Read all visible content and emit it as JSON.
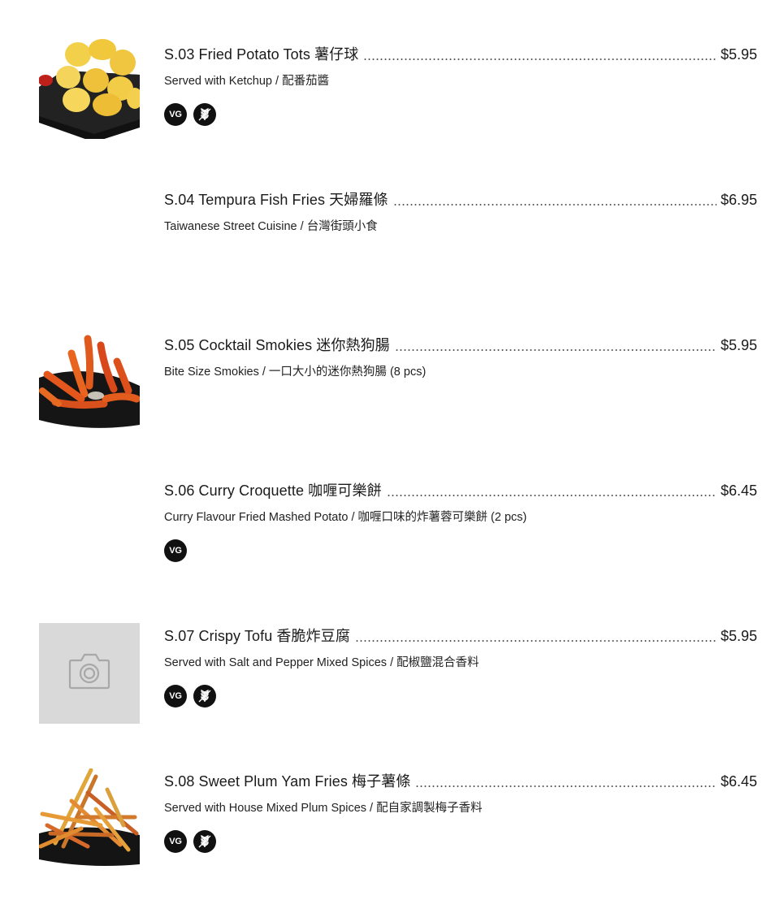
{
  "items": [
    {
      "title": "S.03 Fried Potato Tots 薯仔球",
      "price": "$5.95",
      "description": "Served with Ketchup / 配番茄醬",
      "image": "potato-tots-photo",
      "badges": [
        "VG",
        "GF"
      ]
    },
    {
      "title": "S.04 Tempura Fish Fries 天婦羅條",
      "price": "$6.95",
      "description": "Taiwanese Street Cuisine / 台灣街頭小食",
      "image": "",
      "badges": []
    },
    {
      "title": "S.05 Cocktail Smokies 迷你熱狗腸",
      "price": "$5.95",
      "description": "Bite Size Smokies / 一口大小的迷你熱狗腸 (8 pcs)",
      "image": "smokies-photo",
      "badges": []
    },
    {
      "title": "S.06 Curry Croquette 咖喱可樂餅",
      "price": "$6.45",
      "description": "Curry Flavour Fried Mashed Potato / 咖喱口味的炸薯蓉可樂餅 (2 pcs)",
      "image": "",
      "badges": [
        "VG"
      ]
    },
    {
      "title": "S.07 Crispy Tofu 香脆炸豆腐",
      "price": "$5.95",
      "description": "Served with Salt and Pepper Mixed Spices / 配椒鹽混合香料",
      "image": "camera-placeholder",
      "badges": [
        "VG",
        "GF"
      ]
    },
    {
      "title": "S.08 Sweet Plum Yam Fries 梅子薯條",
      "price": "$6.45",
      "description": "Served with House Mixed Plum Spices / 配自家調製梅子香料",
      "image": "yam-fries-photo",
      "badges": [
        "VG",
        "GF"
      ]
    }
  ],
  "badge_labels": {
    "vegetarian": "VG"
  },
  "colors": {
    "badge_bg": "#111111",
    "placeholder_bg": "#d9d9d9"
  }
}
